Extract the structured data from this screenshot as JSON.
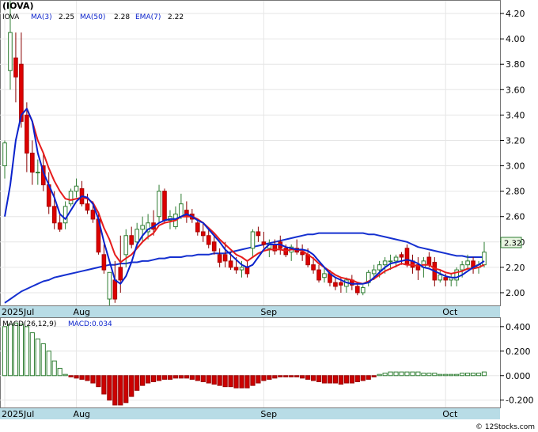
{
  "ticker_label": "(IOVA)",
  "legend": {
    "symbol": "IOVA",
    "ma3_label": "MA(3)",
    "ma3_value": "2.25",
    "ma50_label": "MA(50)",
    "ma50_value": "2.28",
    "ema7_label": "EMA(7)",
    "ema7_value": "2.22"
  },
  "macd_legend": {
    "label": "MACD(26,12,9)",
    "value_label": "MACD:0.034"
  },
  "last_price_tag": "2.32",
  "watermark": "© 12Stocks.com",
  "colors": {
    "up_candle": "#ffffff",
    "up_outline": "#2e7d32",
    "down_candle": "#dd0000",
    "ma3": "#0a22cc",
    "ma50": "#1530d0",
    "ema7": "#e61c1c",
    "axis_band": "#b8dce6",
    "hist_pos": "#2e7d32",
    "hist_neg": "#cc0000"
  },
  "chart_data": [
    {
      "type": "candlestick",
      "title": "(IOVA)",
      "x_tick_labels": [
        "2025Jul",
        "Aug",
        "Sep",
        "Oct"
      ],
      "x_tick_index": [
        0,
        13,
        47,
        80
      ],
      "y_ticks": [
        "2.00",
        "2.20",
        "2.40",
        "2.60",
        "2.80",
        "3.00",
        "3.20",
        "3.40",
        "3.60",
        "3.80",
        "4.00",
        "4.20"
      ],
      "ylim": [
        1.9,
        4.3
      ],
      "ohlc": [
        [
          3.0,
          3.2,
          2.9,
          3.18
        ],
        [
          3.75,
          4.3,
          3.6,
          4.05
        ],
        [
          3.85,
          4.05,
          3.5,
          3.7
        ],
        [
          3.8,
          4.05,
          3.3,
          3.35
        ],
        [
          3.4,
          3.5,
          2.95,
          3.1
        ],
        [
          3.1,
          3.2,
          2.85,
          2.95
        ],
        [
          2.95,
          3.05,
          2.85,
          2.95
        ],
        [
          3.0,
          3.1,
          2.8,
          2.85
        ],
        [
          2.85,
          2.95,
          2.62,
          2.68
        ],
        [
          2.68,
          2.8,
          2.5,
          2.55
        ],
        [
          2.55,
          2.62,
          2.48,
          2.5
        ],
        [
          2.55,
          2.72,
          2.5,
          2.68
        ],
        [
          2.7,
          2.82,
          2.68,
          2.8
        ],
        [
          2.8,
          2.9,
          2.75,
          2.84
        ],
        [
          2.82,
          2.88,
          2.68,
          2.7
        ],
        [
          2.7,
          2.78,
          2.62,
          2.65
        ],
        [
          2.65,
          2.72,
          2.55,
          2.58
        ],
        [
          2.58,
          2.62,
          2.3,
          2.32
        ],
        [
          2.3,
          2.38,
          2.15,
          2.18
        ],
        [
          1.95,
          2.1,
          1.9,
          2.16
        ],
        [
          2.1,
          2.25,
          1.92,
          1.95
        ],
        [
          2.2,
          2.45,
          2.0,
          2.1
        ],
        [
          2.3,
          2.5,
          2.2,
          2.45
        ],
        [
          2.45,
          2.52,
          2.35,
          2.38
        ],
        [
          2.4,
          2.55,
          2.35,
          2.5
        ],
        [
          2.5,
          2.6,
          2.4,
          2.53
        ],
        [
          2.48,
          2.62,
          2.42,
          2.55
        ],
        [
          2.55,
          2.65,
          2.45,
          2.5
        ],
        [
          2.6,
          2.85,
          2.55,
          2.8
        ],
        [
          2.8,
          2.82,
          2.55,
          2.57
        ],
        [
          2.57,
          2.65,
          2.5,
          2.6
        ],
        [
          2.52,
          2.68,
          2.5,
          2.62
        ],
        [
          2.6,
          2.78,
          2.58,
          2.7
        ],
        [
          2.65,
          2.72,
          2.55,
          2.6
        ],
        [
          2.62,
          2.66,
          2.55,
          2.58
        ],
        [
          2.55,
          2.58,
          2.45,
          2.48
        ],
        [
          2.48,
          2.55,
          2.4,
          2.45
        ],
        [
          2.45,
          2.5,
          2.35,
          2.38
        ],
        [
          2.4,
          2.45,
          2.3,
          2.33
        ],
        [
          2.3,
          2.35,
          2.2,
          2.24
        ],
        [
          2.3,
          2.4,
          2.2,
          2.25
        ],
        [
          2.25,
          2.32,
          2.18,
          2.2
        ],
        [
          2.2,
          2.28,
          2.15,
          2.18
        ],
        [
          2.18,
          2.25,
          2.12,
          2.2
        ],
        [
          2.2,
          2.25,
          2.12,
          2.15
        ],
        [
          2.35,
          2.5,
          2.28,
          2.48
        ],
        [
          2.48,
          2.52,
          2.4,
          2.45
        ],
        [
          2.4,
          2.48,
          2.35,
          2.38
        ],
        [
          2.35,
          2.42,
          2.28,
          2.38
        ],
        [
          2.38,
          2.42,
          2.3,
          2.33
        ],
        [
          2.4,
          2.45,
          2.3,
          2.35
        ],
        [
          2.35,
          2.38,
          2.28,
          2.3
        ],
        [
          2.32,
          2.38,
          2.25,
          2.36
        ],
        [
          2.35,
          2.42,
          2.3,
          2.32
        ],
        [
          2.32,
          2.38,
          2.25,
          2.3
        ],
        [
          2.3,
          2.35,
          2.2,
          2.22
        ],
        [
          2.22,
          2.28,
          2.15,
          2.18
        ],
        [
          2.18,
          2.22,
          2.08,
          2.1
        ],
        [
          2.12,
          2.2,
          2.08,
          2.15
        ],
        [
          2.15,
          2.18,
          2.05,
          2.08
        ],
        [
          2.08,
          2.12,
          2.02,
          2.05
        ],
        [
          2.08,
          2.12,
          2.0,
          2.06
        ],
        [
          2.05,
          2.12,
          2.0,
          2.1
        ],
        [
          2.1,
          2.14,
          2.02,
          2.06
        ],
        [
          2.05,
          2.08,
          1.98,
          2.0
        ],
        [
          2.0,
          2.06,
          1.98,
          2.04
        ],
        [
          2.08,
          2.18,
          2.05,
          2.16
        ],
        [
          2.15,
          2.22,
          2.1,
          2.18
        ],
        [
          2.18,
          2.25,
          2.12,
          2.22
        ],
        [
          2.22,
          2.28,
          2.15,
          2.25
        ],
        [
          2.25,
          2.3,
          2.18,
          2.25
        ],
        [
          2.25,
          2.3,
          2.2,
          2.28
        ],
        [
          2.3,
          2.32,
          2.22,
          2.28
        ],
        [
          2.35,
          2.38,
          2.2,
          2.22
        ],
        [
          2.25,
          2.3,
          2.15,
          2.2
        ],
        [
          2.22,
          2.28,
          2.1,
          2.18
        ],
        [
          2.2,
          2.28,
          2.12,
          2.25
        ],
        [
          2.28,
          2.32,
          2.2,
          2.22
        ],
        [
          2.24,
          2.28,
          2.05,
          2.1
        ],
        [
          2.1,
          2.18,
          2.08,
          2.14
        ],
        [
          2.12,
          2.15,
          2.05,
          2.1
        ],
        [
          2.1,
          2.15,
          2.05,
          2.12
        ],
        [
          2.1,
          2.2,
          2.05,
          2.18
        ],
        [
          2.18,
          2.25,
          2.12,
          2.22
        ],
        [
          2.22,
          2.3,
          2.18,
          2.25
        ],
        [
          2.25,
          2.28,
          2.15,
          2.2
        ],
        [
          2.2,
          2.25,
          2.15,
          2.22
        ],
        [
          2.22,
          2.4,
          2.2,
          2.32
        ]
      ],
      "ma3": [
        2.6,
        2.85,
        3.2,
        3.4,
        3.45,
        3.35,
        3.1,
        2.95,
        2.85,
        2.75,
        2.62,
        2.58,
        2.65,
        2.72,
        2.76,
        2.75,
        2.7,
        2.58,
        2.4,
        2.25,
        2.1,
        2.07,
        2.13,
        2.24,
        2.38,
        2.45,
        2.5,
        2.52,
        2.55,
        2.57,
        2.58,
        2.58,
        2.6,
        2.62,
        2.6,
        2.57,
        2.55,
        2.5,
        2.45,
        2.4,
        2.34,
        2.3,
        2.26,
        2.22,
        2.2,
        2.22,
        2.28,
        2.34,
        2.38,
        2.38,
        2.38,
        2.36,
        2.35,
        2.34,
        2.34,
        2.33,
        2.3,
        2.25,
        2.2,
        2.15,
        2.12,
        2.1,
        2.08,
        2.07,
        2.07,
        2.07,
        2.08,
        2.12,
        2.16,
        2.2,
        2.23,
        2.24,
        2.25,
        2.26,
        2.25,
        2.23,
        2.2,
        2.19,
        2.17,
        2.15,
        2.13,
        2.12,
        2.12,
        2.14,
        2.17,
        2.2,
        2.22,
        2.25
      ],
      "ema7": [
        null,
        null,
        null,
        3.4,
        3.45,
        3.35,
        3.2,
        3.1,
        2.98,
        2.88,
        2.8,
        2.74,
        2.73,
        2.74,
        2.75,
        2.74,
        2.71,
        2.63,
        2.51,
        2.42,
        2.3,
        2.24,
        2.27,
        2.3,
        2.35,
        2.4,
        2.44,
        2.47,
        2.53,
        2.55,
        2.56,
        2.57,
        2.6,
        2.6,
        2.6,
        2.58,
        2.55,
        2.51,
        2.47,
        2.42,
        2.38,
        2.34,
        2.3,
        2.28,
        2.25,
        2.28,
        2.31,
        2.33,
        2.34,
        2.34,
        2.34,
        2.33,
        2.34,
        2.34,
        2.33,
        2.3,
        2.27,
        2.23,
        2.2,
        2.17,
        2.14,
        2.12,
        2.11,
        2.1,
        2.08,
        2.07,
        2.09,
        2.11,
        2.14,
        2.17,
        2.19,
        2.21,
        2.23,
        2.22,
        2.22,
        2.21,
        2.22,
        2.22,
        2.19,
        2.18,
        2.16,
        2.15,
        2.16,
        2.17,
        2.19,
        2.19,
        2.2,
        2.22
      ],
      "ma50": [
        1.92,
        1.95,
        1.98,
        2.01,
        2.03,
        2.05,
        2.07,
        2.09,
        2.1,
        2.12,
        2.13,
        2.14,
        2.15,
        2.16,
        2.17,
        2.18,
        2.19,
        2.2,
        2.21,
        2.22,
        2.22,
        2.23,
        2.23,
        2.24,
        2.24,
        2.25,
        2.25,
        2.26,
        2.27,
        2.27,
        2.28,
        2.28,
        2.28,
        2.29,
        2.29,
        2.3,
        2.3,
        2.3,
        2.31,
        2.31,
        2.31,
        2.32,
        2.33,
        2.34,
        2.35,
        2.36,
        2.37,
        2.38,
        2.39,
        2.4,
        2.41,
        2.42,
        2.43,
        2.44,
        2.45,
        2.46,
        2.46,
        2.47,
        2.47,
        2.47,
        2.47,
        2.47,
        2.47,
        2.47,
        2.47,
        2.47,
        2.46,
        2.46,
        2.45,
        2.44,
        2.43,
        2.42,
        2.41,
        2.4,
        2.38,
        2.36,
        2.35,
        2.34,
        2.33,
        2.32,
        2.31,
        2.3,
        2.29,
        2.29,
        2.28,
        2.28,
        2.28,
        2.28
      ]
    },
    {
      "type": "bar",
      "title": "MACD(26,12,9)",
      "y_ticks": [
        "0.400",
        "0.200",
        "0.000",
        "-0.200"
      ],
      "ylim": [
        -0.26,
        0.47
      ],
      "values": [
        0.4,
        0.42,
        0.43,
        0.42,
        0.4,
        0.35,
        0.3,
        0.26,
        0.2,
        0.12,
        0.06,
        0.01,
        -0.01,
        -0.02,
        -0.03,
        -0.04,
        -0.06,
        -0.09,
        -0.15,
        -0.2,
        -0.24,
        -0.24,
        -0.22,
        -0.17,
        -0.12,
        -0.08,
        -0.06,
        -0.05,
        -0.04,
        -0.03,
        -0.03,
        -0.02,
        -0.02,
        -0.02,
        -0.03,
        -0.04,
        -0.05,
        -0.06,
        -0.07,
        -0.08,
        -0.09,
        -0.09,
        -0.1,
        -0.1,
        -0.1,
        -0.08,
        -0.06,
        -0.04,
        -0.03,
        -0.02,
        -0.01,
        -0.01,
        -0.01,
        -0.01,
        -0.02,
        -0.03,
        -0.04,
        -0.05,
        -0.06,
        -0.06,
        -0.06,
        -0.07,
        -0.06,
        -0.06,
        -0.05,
        -0.04,
        -0.03,
        -0.01,
        0.01,
        0.02,
        0.03,
        0.03,
        0.03,
        0.03,
        0.03,
        0.03,
        0.02,
        0.02,
        0.02,
        0.01,
        0.01,
        0.01,
        0.01,
        0.02,
        0.02,
        0.02,
        0.02,
        0.03
      ]
    }
  ]
}
